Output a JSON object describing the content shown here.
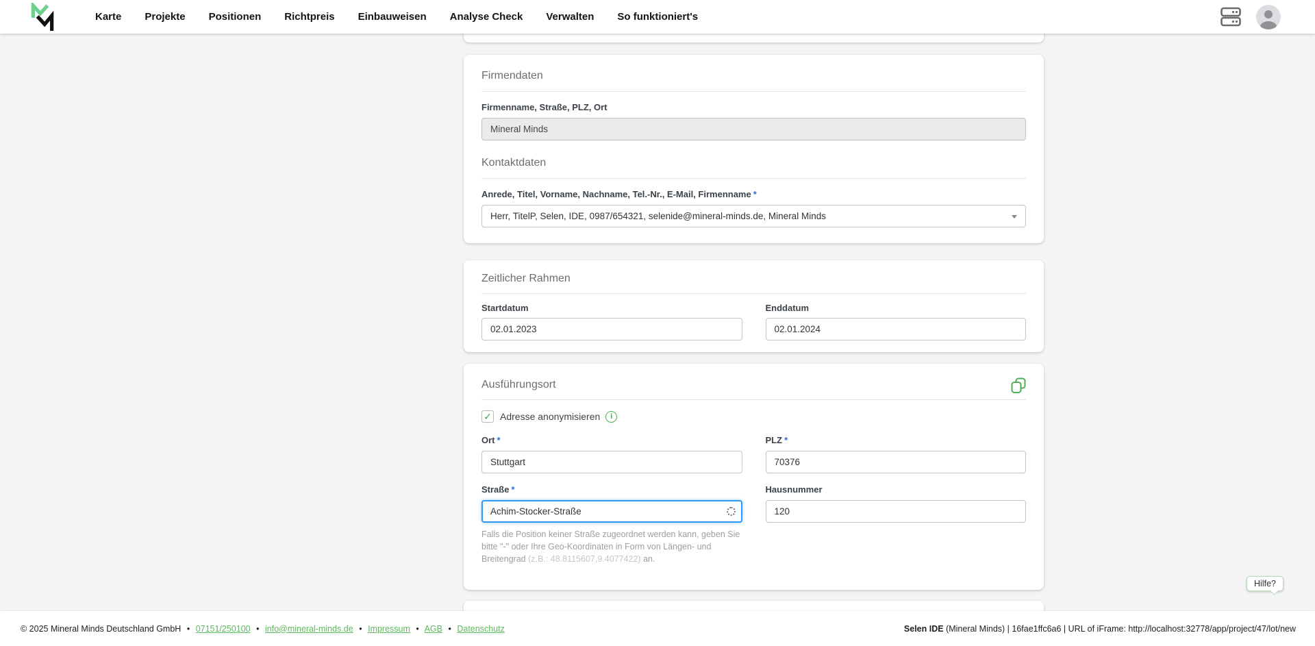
{
  "colors": {
    "accent_green": "#4caf50",
    "link_green": "#5cb85c",
    "focus_blue": "#2f9bf4",
    "asterisk_blue": "#2a6fd4",
    "page_background": "#f4f4f5"
  },
  "nav": {
    "items": [
      {
        "label": "Karte"
      },
      {
        "label": "Projekte"
      },
      {
        "label": "Positionen"
      },
      {
        "label": "Richtpreis"
      },
      {
        "label": "Einbauweisen"
      },
      {
        "label": "Analyse Check"
      },
      {
        "label": "Verwalten"
      },
      {
        "label": "So funktioniert's"
      }
    ]
  },
  "firmendaten": {
    "title": "Firmendaten",
    "firma_label": "Firmenname, Straße, PLZ, Ort",
    "firma_value": "Mineral Minds",
    "kontakt_title": "Kontaktdaten",
    "kontakt_label": "Anrede, Titel, Vorname, Nachname, Tel.-Nr., E-Mail, Firmenname",
    "required_mark": "*",
    "kontakt_value": "Herr, TitelP, Selen, IDE, 0987/654321, selenide@mineral-minds.de, Mineral Minds"
  },
  "zeitraum": {
    "title": "Zeitlicher Rahmen",
    "start_label": "Startdatum",
    "start_value": "02.01.2023",
    "end_label": "Enddatum",
    "end_value": "02.01.2024"
  },
  "ausfuehrungsort": {
    "title": "Ausführungsort",
    "anonymisieren_label": "Adresse anonymisieren",
    "required_mark": "*",
    "ort_label": "Ort",
    "ort_value": "Stuttgart",
    "plz_label": "PLZ",
    "plz_value": "70376",
    "strasse_label": "Straße",
    "strasse_value": "Achim-Stocker-Straße",
    "hausnummer_label": "Hausnummer",
    "hausnummer_value": "120",
    "helper_text_1": "Falls die Position keiner Straße zugeordnet werden kann, geben Sie bitte \"-\" oder Ihre Geo-Koordinaten in Form von Längen- und Breitengrad ",
    "helper_example": "(z.B.: 48.8115607,9.4077422)",
    "helper_text_2": " an."
  },
  "help": {
    "label": "Hilfe?"
  },
  "footer": {
    "copyright": "© 2025 Mineral Minds Deutschland GmbH",
    "separator": "•",
    "links": [
      {
        "label": "07151/250100"
      },
      {
        "label": "info@mineral-minds.de"
      },
      {
        "label": "Impressum"
      },
      {
        "label": "AGB"
      },
      {
        "label": "Datenschutz"
      }
    ],
    "debug_bold": "Selen IDE",
    "debug_rest": " (Mineral Minds) | 16fae1ffc6a6 | URL of iFrame: http://localhost:32778/app/project/47/lot/new"
  },
  "icons": {
    "checkbox_check": "✓",
    "info": "i"
  }
}
